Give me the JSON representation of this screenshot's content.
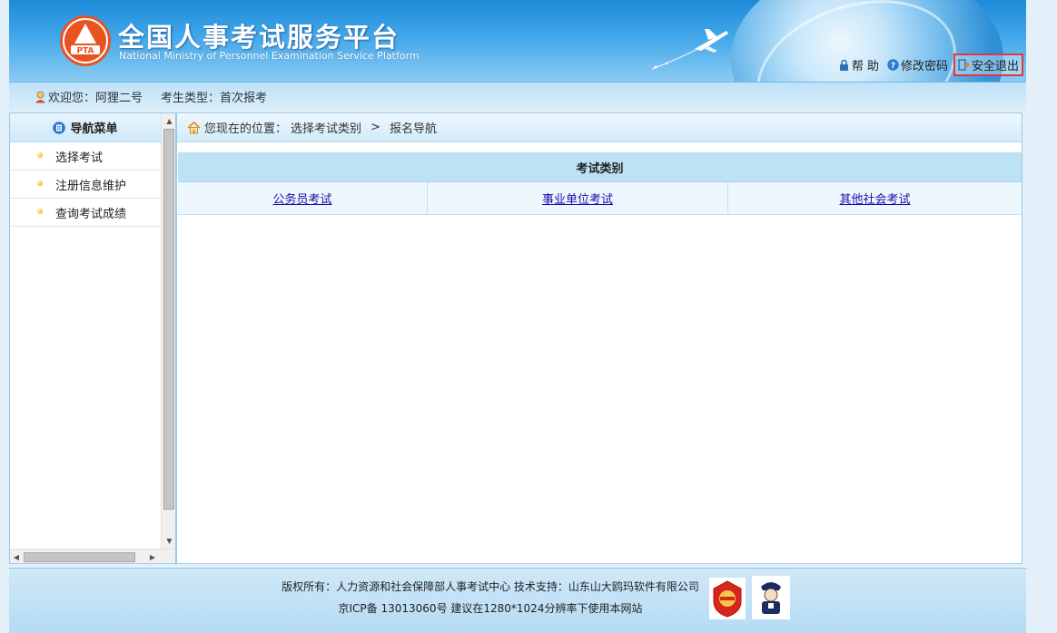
{
  "header": {
    "title": "全国人事考试服务平台",
    "subtitle": "National Ministry of Personnel Examination Service Platform",
    "logo_text": "PTA",
    "links": {
      "help": "帮 助",
      "change_password": "修改密码",
      "logout": "安全退出"
    }
  },
  "userbar": {
    "welcome": "欢迎您：阿狸二号",
    "candidate_type": "考生类型：首次报考"
  },
  "sidebar": {
    "title": "导航菜单",
    "items": [
      {
        "label": "选择考试"
      },
      {
        "label": "注册信息维护"
      },
      {
        "label": "查询考试成绩"
      }
    ]
  },
  "breadcrumb": {
    "prefix": "您现在的位置：",
    "path": [
      "选择考试类别",
      "报名导航"
    ],
    "separator": ">"
  },
  "exam_table": {
    "header": "考试类别",
    "links": [
      "公务员考试",
      "事业单位考试",
      "其他社会考试"
    ]
  },
  "footer": {
    "line1": "版权所有：人力资源和社会保障部人事考试中心  技术支持：山东山大鸥玛软件有限公司",
    "line2": "京ICP备 13013060号  建议在1280*1024分辨率下使用本网站"
  },
  "colors": {
    "header_blue": "#1d8ad8",
    "link_blue": "#1a0dab",
    "logout_highlight": "#e0383b",
    "table_header_bg": "#bde2f6"
  }
}
